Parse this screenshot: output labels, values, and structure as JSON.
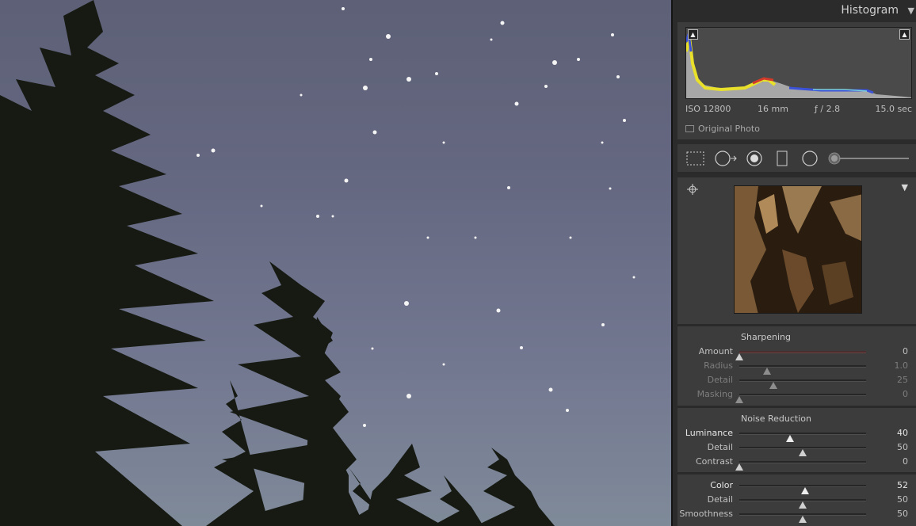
{
  "histogram": {
    "title": "Histogram",
    "exif": {
      "iso": "ISO 12800",
      "focal_length": "16 mm",
      "aperture": "ƒ / 2.8",
      "shutter": "15.0 sec"
    },
    "original_photo_label": "Original Photo"
  },
  "tools": [
    "crop-overlay-icon",
    "spot-removal-icon",
    "red-eye-icon",
    "graduated-filter-icon",
    "radial-filter-icon",
    "adjustment-brush-icon"
  ],
  "sharpening": {
    "title": "Sharpening",
    "sliders": [
      {
        "label": "Amount",
        "value": "0",
        "fraction": 0.0,
        "state": "normal"
      },
      {
        "label": "Radius",
        "value": "1.0",
        "fraction": 0.22,
        "state": "dim"
      },
      {
        "label": "Detail",
        "value": "25",
        "fraction": 0.27,
        "state": "dim"
      },
      {
        "label": "Masking",
        "value": "0",
        "fraction": 0.0,
        "state": "dim"
      }
    ]
  },
  "noise_reduction": {
    "title": "Noise Reduction",
    "sliders": [
      {
        "label": "Luminance",
        "value": "40",
        "fraction": 0.4,
        "state": "bright"
      },
      {
        "label": "Detail",
        "value": "50",
        "fraction": 0.5,
        "state": "normal"
      },
      {
        "label": "Contrast",
        "value": "0",
        "fraction": 0.0,
        "state": "normal"
      }
    ],
    "color_sliders": [
      {
        "label": "Color",
        "value": "52",
        "fraction": 0.52,
        "state": "bright"
      },
      {
        "label": "Detail",
        "value": "50",
        "fraction": 0.5,
        "state": "normal"
      },
      {
        "label": "Smoothness",
        "value": "50",
        "fraction": 0.5,
        "state": "normal"
      }
    ]
  }
}
